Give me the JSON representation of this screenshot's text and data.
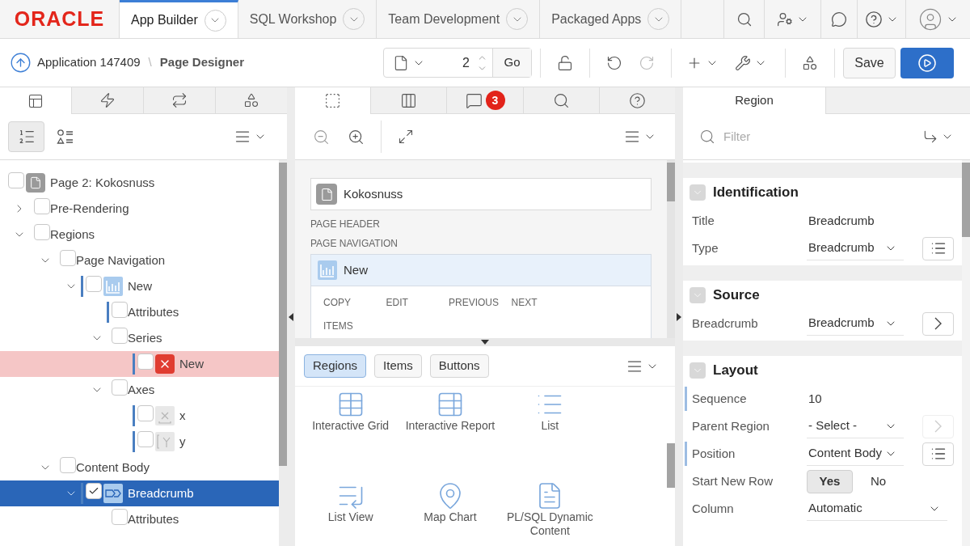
{
  "top_nav": {
    "logo": "ORACLE",
    "tabs": [
      {
        "label": "App Builder",
        "selected": true
      },
      {
        "label": "SQL Workshop",
        "selected": false
      },
      {
        "label": "Team Development",
        "selected": false
      },
      {
        "label": "Packaged Apps",
        "selected": false
      }
    ]
  },
  "toolbar": {
    "breadcrumb": {
      "parent": "Application 147409",
      "separator": "\\",
      "current": "Page Designer"
    },
    "page_number": "2",
    "go_label": "Go",
    "save_label": "Save"
  },
  "left_panel": {
    "tabs": [
      {
        "kind": "rendering",
        "selected": true
      },
      {
        "kind": "dynamic-actions",
        "selected": false
      },
      {
        "kind": "processing",
        "selected": false
      },
      {
        "kind": "shared",
        "selected": false
      }
    ],
    "view_buttons": [
      {
        "kind": "ordered",
        "selected": true
      },
      {
        "kind": "grouped",
        "selected": false
      }
    ],
    "tree": [
      {
        "label": "Page 2: Kokosnuss",
        "kind": "page",
        "checked": false,
        "selected": false,
        "changed": false,
        "children": [
          {
            "label": "Pre-Rendering",
            "checked": false,
            "selected": false,
            "changed": false,
            "expanded": false
          },
          {
            "label": "Regions",
            "checked": false,
            "selected": false,
            "changed": false,
            "expanded": true,
            "children": [
              {
                "label": "Page Navigation",
                "checked": false,
                "selected": false,
                "changed": false,
                "expanded": true,
                "children": [
                  {
                    "label": "New",
                    "kind": "chart",
                    "checked": false,
                    "selected": false,
                    "changed": true,
                    "expanded": true,
                    "children": [
                      {
                        "label": "Attributes",
                        "checked": false,
                        "selected": false,
                        "changed": true
                      },
                      {
                        "label": "Series",
                        "checked": false,
                        "selected": false,
                        "changed": false,
                        "expanded": true,
                        "children": [
                          {
                            "label": "New",
                            "kind": "error",
                            "checked": false,
                            "selected": false,
                            "changed": true
                          }
                        ]
                      },
                      {
                        "label": "Axes",
                        "checked": false,
                        "selected": false,
                        "changed": false,
                        "expanded": true,
                        "children": [
                          {
                            "label": "x",
                            "kind": "axis-x",
                            "checked": false,
                            "selected": false,
                            "changed": true
                          },
                          {
                            "label": "y",
                            "kind": "axis-y",
                            "checked": false,
                            "selected": false,
                            "changed": true
                          }
                        ]
                      }
                    ]
                  }
                ]
              },
              {
                "label": "Content Body",
                "checked": false,
                "selected": false,
                "changed": false,
                "expanded": true,
                "children": [
                  {
                    "label": "Breadcrumb",
                    "kind": "breadcrumb",
                    "checked": true,
                    "selected": true,
                    "changed": true,
                    "expanded": true,
                    "children": [
                      {
                        "label": "Attributes",
                        "checked": false,
                        "selected": false,
                        "changed": false
                      }
                    ]
                  }
                ]
              }
            ]
          }
        ]
      }
    ]
  },
  "middle_panel": {
    "tabs": [
      {
        "kind": "layout",
        "selected": true
      },
      {
        "kind": "components",
        "selected": false
      },
      {
        "kind": "messages",
        "selected": false,
        "badge": "3"
      },
      {
        "kind": "search",
        "selected": false
      },
      {
        "kind": "help",
        "selected": false
      }
    ],
    "canvas": {
      "page_title": "Kokosnuss",
      "sections": [
        "PAGE HEADER",
        "PAGE NAVIGATION"
      ],
      "region": {
        "title": "New",
        "buttons": [
          "COPY",
          "EDIT",
          "PREVIOUS",
          "NEXT",
          "ITEMS"
        ]
      }
    },
    "gallery": {
      "filters": [
        {
          "label": "Regions",
          "selected": true
        },
        {
          "label": "Items",
          "selected": false
        },
        {
          "label": "Buttons",
          "selected": false
        }
      ],
      "items": [
        {
          "label": "Interactive Grid",
          "kind": "grid"
        },
        {
          "label": "Interactive Report",
          "kind": "report"
        },
        {
          "label": "List",
          "kind": "list"
        },
        {
          "label": "List View",
          "kind": "list-view"
        },
        {
          "label": "Map Chart",
          "kind": "map"
        },
        {
          "label": "PL/SQL Dynamic Content",
          "kind": "dynamic"
        }
      ]
    }
  },
  "right_panel": {
    "tabs": [
      {
        "label": "Region",
        "selected": true
      }
    ],
    "filter_placeholder": "Filter",
    "groups": [
      {
        "title": "Identification",
        "properties": [
          {
            "label": "Title",
            "kind": "text",
            "value": "Breadcrumb",
            "changed": false
          },
          {
            "label": "Type",
            "kind": "select",
            "value": "Breadcrumb",
            "changed": false,
            "action": {
              "kind": "list",
              "disabled": false
            }
          }
        ]
      },
      {
        "title": "Source",
        "properties": [
          {
            "label": "Breadcrumb",
            "kind": "select",
            "value": "Breadcrumb",
            "changed": false,
            "action": {
              "kind": "next",
              "disabled": false
            }
          }
        ]
      },
      {
        "title": "Layout",
        "properties": [
          {
            "label": "Sequence",
            "kind": "text",
            "value": "10",
            "changed": true
          },
          {
            "label": "Parent Region",
            "kind": "select",
            "value": "- Select -",
            "changed": false,
            "action": {
              "kind": "next",
              "disabled": true
            }
          },
          {
            "label": "Position",
            "kind": "select",
            "value": "Content Body",
            "changed": true,
            "action": {
              "kind": "list",
              "disabled": false
            }
          },
          {
            "label": "Start New Row",
            "kind": "toggle",
            "changed": false,
            "options": [
              {
                "label": "Yes",
                "selected": true
              },
              {
                "label": "No",
                "selected": false
              }
            ]
          },
          {
            "label": "Column",
            "kind": "select",
            "value": "Automatic",
            "changed": false
          }
        ]
      }
    ]
  }
}
